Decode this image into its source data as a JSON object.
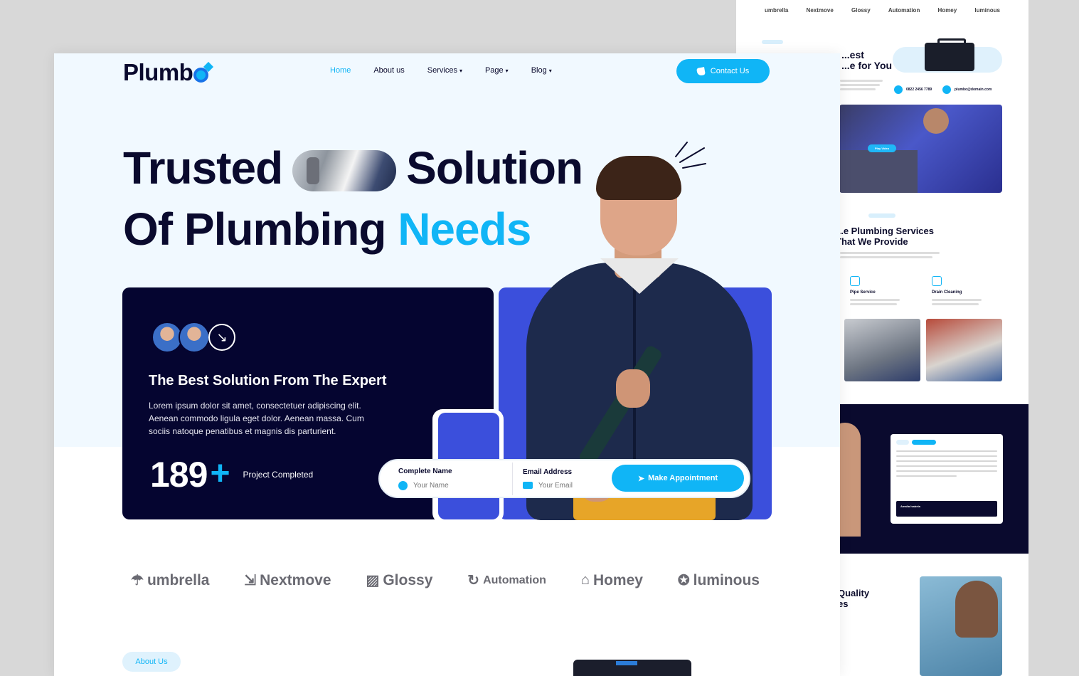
{
  "brand": {
    "name": "Plumb"
  },
  "nav": {
    "items": [
      {
        "label": "Home",
        "active": true,
        "dropdown": false
      },
      {
        "label": "About us",
        "active": false,
        "dropdown": false
      },
      {
        "label": "Services",
        "active": false,
        "dropdown": true
      },
      {
        "label": "Page",
        "active": false,
        "dropdown": true
      },
      {
        "label": "Blog",
        "active": false,
        "dropdown": true
      }
    ],
    "contact_label": "Contact Us"
  },
  "hero": {
    "line1_a": "Trusted",
    "line1_b": "Solution",
    "line2_a": "Of Plumbing",
    "line2_b": "Needs"
  },
  "expert_card": {
    "title": "The Best Solution From The Expert",
    "text": "Lorem ipsum dolor sit amet, consectetuer adipiscing elit. Aenean commodo ligula eget dolor. Aenean massa. Cum sociis natoque penatibus et magnis dis parturient.",
    "stat_number": "189",
    "stat_plus": "+",
    "stat_label": "Project Completed"
  },
  "appointment": {
    "name_label": "Complete Name",
    "name_placeholder": "Your Name",
    "email_label": "Email Address",
    "email_placeholder": "Your Email",
    "button_label": "Make Appointment"
  },
  "partners": [
    {
      "name": "umbrella",
      "icon": "umbrella-icon"
    },
    {
      "name": "Nextmove",
      "icon": "nextmove-icon"
    },
    {
      "name": "Glossy",
      "icon": "glossy-icon"
    },
    {
      "name": "Automation",
      "icon": "automation-icon"
    },
    {
      "name": "Homey",
      "icon": "homey-icon"
    },
    {
      "name": "luminous",
      "icon": "luminous-icon"
    }
  ],
  "about_pill": "About Us",
  "preview": {
    "logos": [
      "umbrella",
      "Nextmove",
      "Glossy",
      "Automation",
      "Homey",
      "luminous"
    ],
    "heading1": "...est\n...e for You",
    "phone": "0822 2456 7789",
    "email": "plumbo@domain.com",
    "play_label": "Play Video",
    "services_heading": "...e Plumbing Services\nThat We Provide",
    "service1": "Pipe Service",
    "service2": "Drain Cleaning",
    "testimonial_name": "Amalia Isabela",
    "quality_heading": "Quality\nes"
  },
  "colors": {
    "accent": "#10b5f6",
    "navy": "#050530",
    "royal": "#3b4fdc",
    "hero_bg": "#f1f9ff"
  }
}
